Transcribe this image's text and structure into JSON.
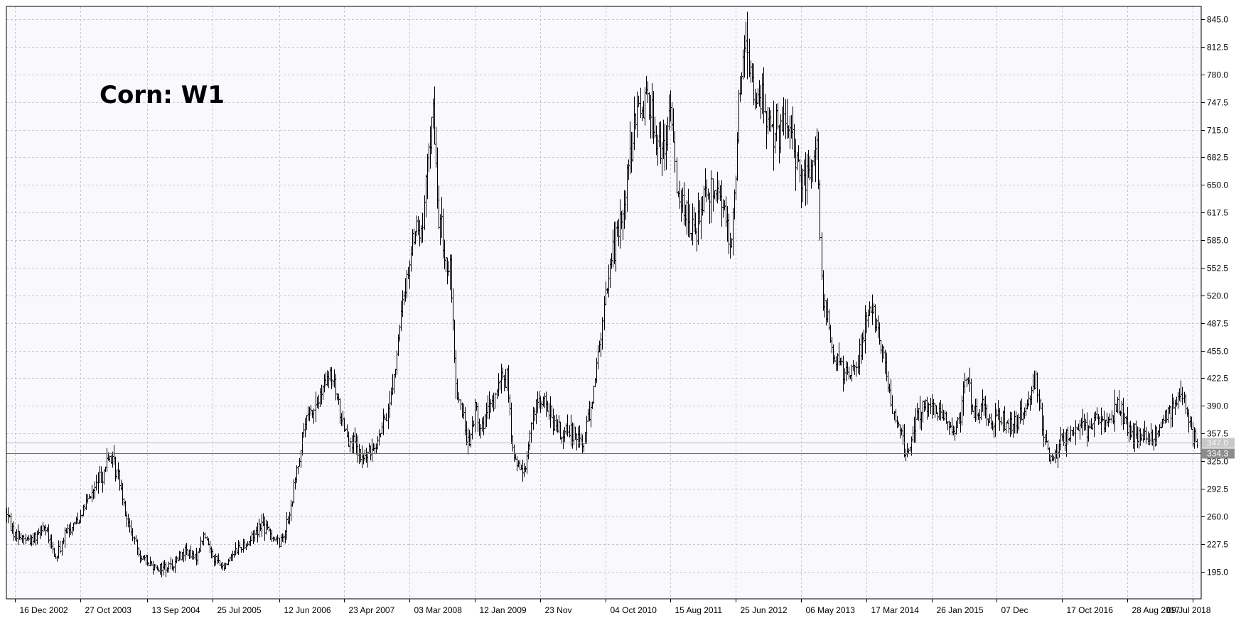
{
  "colors": {
    "background": "#f8f8fd",
    "grid": "#c6c6cc",
    "bars": "#000000",
    "axis": "#000000",
    "tag_bid": "#c8c8c8",
    "tag_last": "#8c8c8c"
  },
  "chart_data": {
    "type": "bar",
    "subtype": "ohlc-weekly",
    "title": "Corn: W1",
    "symbol": "Corn",
    "timeframe": "W1",
    "ylim": [
      163,
      860
    ],
    "yticks": [
      195.0,
      227.5,
      260.0,
      292.5,
      325.0,
      357.5,
      390.0,
      422.5,
      455.0,
      487.5,
      520.0,
      552.5,
      585.0,
      617.5,
      650.0,
      682.5,
      715.0,
      747.5,
      780.0,
      812.5,
      845.0
    ],
    "xlim": [
      "2002-11-04",
      "2018-08-20"
    ],
    "xticks": [
      "2002-12-16",
      "2003-10-27",
      "2004-09-13",
      "2005-07-25",
      "2006-06-12",
      "2007-04-23",
      "2008-03-03",
      "2009-01-12",
      "2009-11-23",
      "2010-10-04",
      "2011-08-15",
      "2012-06-25",
      "2013-05-06",
      "2014-03-17",
      "2015-01-26",
      "2015-12-07",
      "2016-10-17",
      "2017-08-28",
      "2018-07-09"
    ],
    "xtick_labels": [
      "16 Dec 2002",
      "27 Oct 2003",
      "13 Sep 2004",
      "25 Jul 2005",
      "12 Jun 2006",
      "23 Apr 2007",
      "03 Mar 2008",
      "12 Jan 2009",
      "23 Nov",
      "04 Oct 2010",
      "15 Aug 2011",
      "25 Jun 2012",
      "06 May 2013",
      "17 Mar 2014",
      "26 Jan 2015",
      "07 Dec",
      "17 Oct 2016",
      "28 Aug 2017",
      "09 Jul 2018"
    ],
    "grid": true,
    "price_lines": [
      {
        "label": "347.0",
        "value": 347.0,
        "style": "bid"
      },
      {
        "label": "334.3",
        "value": 334.3,
        "style": "last"
      }
    ],
    "price_points": [
      [
        "2002-11-04",
        265
      ],
      [
        "2002-12-16",
        238
      ],
      [
        "2003-03-01",
        232
      ],
      [
        "2003-05-01",
        250
      ],
      [
        "2003-06-30",
        210
      ],
      [
        "2003-08-11",
        238
      ],
      [
        "2003-10-27",
        262
      ],
      [
        "2004-01-15",
        298
      ],
      [
        "2004-03-15",
        330
      ],
      [
        "2004-05-01",
        305
      ],
      [
        "2004-06-15",
        250
      ],
      [
        "2004-08-01",
        218
      ],
      [
        "2004-09-13",
        205
      ],
      [
        "2004-11-15",
        200
      ],
      [
        "2005-01-15",
        203
      ],
      [
        "2005-03-15",
        220
      ],
      [
        "2005-05-01",
        210
      ],
      [
        "2005-06-15",
        238
      ],
      [
        "2005-07-25",
        215
      ],
      [
        "2005-09-15",
        198
      ],
      [
        "2005-11-01",
        218
      ],
      [
        "2006-01-15",
        230
      ],
      [
        "2006-03-15",
        252
      ],
      [
        "2006-05-01",
        240
      ],
      [
        "2006-06-12",
        228
      ],
      [
        "2006-08-01",
        260
      ],
      [
        "2006-09-01",
        310
      ],
      [
        "2006-10-15",
        370
      ],
      [
        "2006-12-15",
        395
      ],
      [
        "2007-02-15",
        428
      ],
      [
        "2007-04-23",
        365
      ],
      [
        "2007-06-01",
        345
      ],
      [
        "2007-07-15",
        325
      ],
      [
        "2007-08-15",
        335
      ],
      [
        "2007-10-01",
        350
      ],
      [
        "2007-11-15",
        380
      ],
      [
        "2008-01-01",
        450
      ],
      [
        "2008-02-01",
        520
      ],
      [
        "2008-03-03",
        560
      ],
      [
        "2008-04-01",
        600
      ],
      [
        "2008-05-01",
        590
      ],
      [
        "2008-06-01",
        690
      ],
      [
        "2008-06-20",
        745
      ],
      [
        "2008-07-15",
        630
      ],
      [
        "2008-08-15",
        570
      ],
      [
        "2008-09-15",
        545
      ],
      [
        "2008-10-15",
        410
      ],
      [
        "2008-11-15",
        375
      ],
      [
        "2008-12-15",
        340
      ],
      [
        "2009-01-12",
        390
      ],
      [
        "2009-02-15",
        365
      ],
      [
        "2009-03-15",
        380
      ],
      [
        "2009-04-15",
        395
      ],
      [
        "2009-05-15",
        420
      ],
      [
        "2009-06-15",
        425
      ],
      [
        "2009-07-15",
        330
      ],
      [
        "2009-08-15",
        315
      ],
      [
        "2009-09-15",
        320
      ],
      [
        "2009-10-15",
        375
      ],
      [
        "2009-11-23",
        400
      ],
      [
        "2010-01-01",
        385
      ],
      [
        "2010-02-15",
        360
      ],
      [
        "2010-03-15",
        355
      ],
      [
        "2010-05-15",
        362
      ],
      [
        "2010-06-15",
        345
      ],
      [
        "2010-07-15",
        380
      ],
      [
        "2010-08-15",
        420
      ],
      [
        "2010-09-15",
        480
      ],
      [
        "2010-10-04",
        520
      ],
      [
        "2010-11-01",
        570
      ],
      [
        "2010-12-15",
        600
      ],
      [
        "2011-01-15",
        660
      ],
      [
        "2011-02-15",
        710
      ],
      [
        "2011-04-15",
        760
      ],
      [
        "2011-06-15",
        700
      ],
      [
        "2011-07-15",
        680
      ],
      [
        "2011-08-15",
        740
      ],
      [
        "2011-09-15",
        650
      ],
      [
        "2011-10-15",
        630
      ],
      [
        "2011-11-15",
        600
      ],
      [
        "2011-12-15",
        590
      ],
      [
        "2012-01-15",
        640
      ],
      [
        "2012-03-15",
        650
      ],
      [
        "2012-05-15",
        610
      ],
      [
        "2012-06-01",
        580
      ],
      [
        "2012-06-25",
        660
      ],
      [
        "2012-07-10",
        760
      ],
      [
        "2012-08-10",
        820
      ],
      [
        "2012-09-15",
        760
      ],
      [
        "2012-11-01",
        745
      ],
      [
        "2012-12-15",
        720
      ],
      [
        "2013-01-15",
        710
      ],
      [
        "2013-03-01",
        720
      ],
      [
        "2013-04-15",
        680
      ],
      [
        "2013-05-06",
        660
      ],
      [
        "2013-06-15",
        655
      ],
      [
        "2013-07-20",
        710
      ],
      [
        "2013-08-15",
        520
      ],
      [
        "2013-09-15",
        480
      ],
      [
        "2013-10-15",
        445
      ],
      [
        "2013-11-15",
        435
      ],
      [
        "2013-12-15",
        425
      ],
      [
        "2014-02-01",
        445
      ],
      [
        "2014-03-17",
        490
      ],
      [
        "2014-04-15",
        505
      ],
      [
        "2014-05-15",
        475
      ],
      [
        "2014-06-15",
        445
      ],
      [
        "2014-07-15",
        385
      ],
      [
        "2014-09-01",
        355
      ],
      [
        "2014-10-01",
        330
      ],
      [
        "2014-11-01",
        370
      ],
      [
        "2014-12-15",
        395
      ],
      [
        "2015-01-26",
        380
      ],
      [
        "2015-03-15",
        385
      ],
      [
        "2015-05-15",
        360
      ],
      [
        "2015-06-15",
        380
      ],
      [
        "2015-07-15",
        430
      ],
      [
        "2015-08-15",
        375
      ],
      [
        "2015-10-01",
        385
      ],
      [
        "2015-11-15",
        365
      ],
      [
        "2015-12-07",
        375
      ],
      [
        "2016-02-15",
        365
      ],
      [
        "2016-04-15",
        385
      ],
      [
        "2016-06-15",
        425
      ],
      [
        "2016-07-15",
        360
      ],
      [
        "2016-08-15",
        330
      ],
      [
        "2016-09-15",
        335
      ],
      [
        "2016-10-17",
        352
      ],
      [
        "2017-01-15",
        362
      ],
      [
        "2017-03-15",
        368
      ],
      [
        "2017-05-01",
        372
      ],
      [
        "2017-06-15",
        375
      ],
      [
        "2017-07-10",
        395
      ],
      [
        "2017-08-28",
        360
      ],
      [
        "2017-10-15",
        355
      ],
      [
        "2017-12-15",
        352
      ],
      [
        "2018-02-15",
        370
      ],
      [
        "2018-04-15",
        395
      ],
      [
        "2018-05-20",
        405
      ],
      [
        "2018-06-15",
        380
      ],
      [
        "2018-07-09",
        355
      ],
      [
        "2018-08-01",
        350
      ]
    ]
  }
}
